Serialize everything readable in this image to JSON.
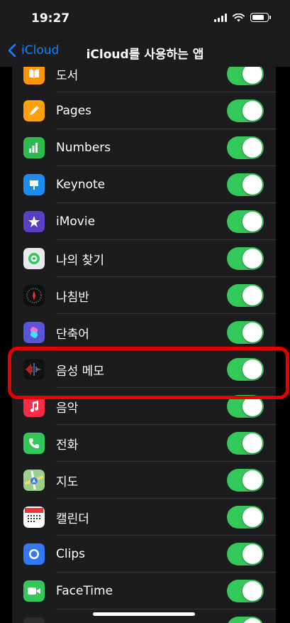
{
  "status_bar": {
    "time": "19:27",
    "battery_level": 0.85
  },
  "nav": {
    "back_label": "iCloud",
    "title": "iCloud를 사용하는 앱"
  },
  "colors": {
    "accent": "#0a84ff",
    "toggle_on": "#34c759",
    "toggle_off": "#39393d",
    "highlight": "#e60000"
  },
  "highlighted_item": "음성 메모",
  "apps": [
    {
      "label": "도서",
      "icon": "books-icon",
      "icon_color": "#ff9500",
      "enabled": true
    },
    {
      "label": "Pages",
      "icon": "pages-icon",
      "icon_color": "#ff9f0a",
      "enabled": true
    },
    {
      "label": "Numbers",
      "icon": "numbers-icon",
      "icon_color": "#30b94d",
      "enabled": true
    },
    {
      "label": "Keynote",
      "icon": "keynote-icon",
      "icon_color": "#1c8cf0",
      "enabled": true
    },
    {
      "label": "iMovie",
      "icon": "imovie-icon",
      "icon_color": "#5b3fc4",
      "enabled": true
    },
    {
      "label": "나의 찾기",
      "icon": "find-my-icon",
      "icon_color": "#e9e9ee",
      "enabled": true
    },
    {
      "label": "나침반",
      "icon": "compass-icon",
      "icon_color": "#111111",
      "enabled": true
    },
    {
      "label": "단축어",
      "icon": "shortcuts-icon",
      "icon_color": "#5856d6",
      "enabled": true
    },
    {
      "label": "음성 메모",
      "icon": "voice-memos-icon",
      "icon_color": "#111111",
      "enabled": true
    },
    {
      "label": "음악",
      "icon": "music-icon",
      "icon_color": "#fa2d48",
      "enabled": true
    },
    {
      "label": "전화",
      "icon": "phone-icon",
      "icon_color": "#34c759",
      "enabled": true
    },
    {
      "label": "지도",
      "icon": "maps-icon",
      "icon_color": "#9bd08a",
      "enabled": true
    },
    {
      "label": "캘린더",
      "icon": "calendar-icon",
      "icon_color": "#ffffff",
      "enabled": true
    },
    {
      "label": "Clips",
      "icon": "clips-icon",
      "icon_color": "#3478f6",
      "enabled": true
    },
    {
      "label": "FaceTime",
      "icon": "facetime-icon",
      "icon_color": "#34c759",
      "enabled": true
    },
    {
      "label": "",
      "icon": "app-icon",
      "icon_color": "#2c2c2e",
      "enabled": true
    }
  ]
}
